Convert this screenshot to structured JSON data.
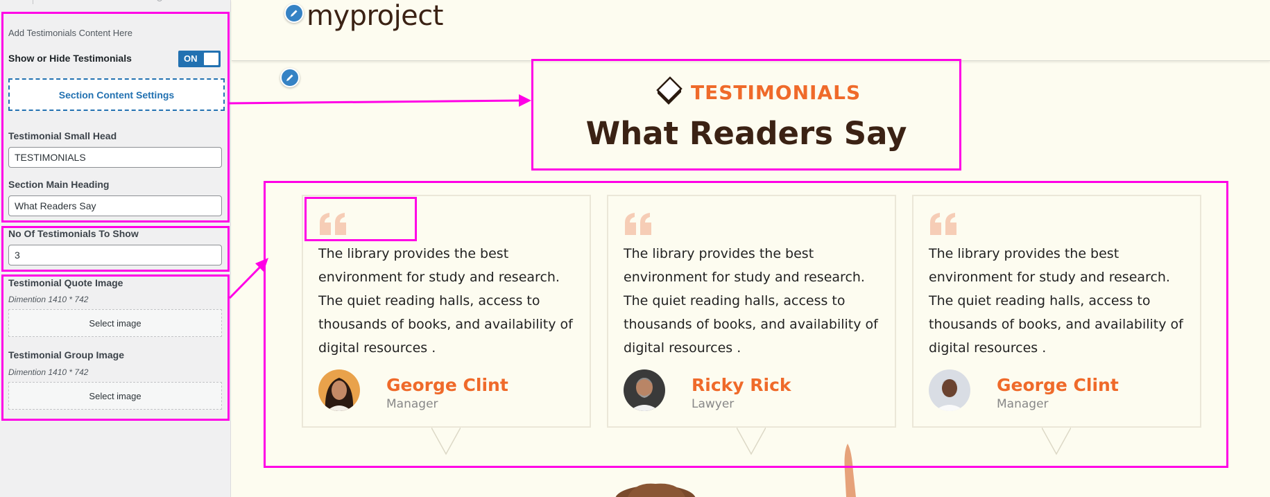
{
  "sidebar": {
    "description": "Add Testimonials Content Here",
    "toggle_label": "Show or Hide Testimonials",
    "toggle_state": "ON",
    "section_settings_label": "Section Content Settings",
    "small_head_label": "Testimonial Small Head",
    "small_head_value": "TESTIMONIALS",
    "main_heading_label": "Section Main Heading",
    "main_heading_value": "What Readers Say",
    "count_label": "No Of Testimonials To Show",
    "count_value": "3",
    "quote_image_label": "Testimonial Quote Image",
    "quote_image_hint": "Dimention 1410 * 742",
    "quote_image_button": "Select image",
    "group_image_label": "Testimonial Group Image",
    "group_image_hint": "Dimention 1410 * 742",
    "group_image_button": "Select image"
  },
  "preview": {
    "site_title": "myproject",
    "small_head": "TESTIMONIALS",
    "heading": "What Readers Say",
    "testimonials": [
      {
        "text": "The library provides the best environment for study and research. The quiet reading halls, access to thousands of books, and availability of digital resources .",
        "name": "George Clint",
        "role": "Manager"
      },
      {
        "text": "The library provides the best environment for study and research. The quiet reading halls, access to thousands of books, and availability of digital resources .",
        "name": "Ricky Rick",
        "role": "Lawyer"
      },
      {
        "text": "The library provides the best environment for study and research. The quiet reading halls, access to thousands of books, and availability of digital resources .",
        "name": "George Clint",
        "role": "Manager"
      }
    ]
  },
  "colors": {
    "accent": "#ef6a2a",
    "heading": "#3b2214",
    "admin_blue": "#2271b1",
    "annotation": "#ff00e6",
    "background": "#fdfcf0"
  },
  "icons": [
    "pencil-icon",
    "book-icon",
    "quote-icon",
    "chevron-icon"
  ]
}
